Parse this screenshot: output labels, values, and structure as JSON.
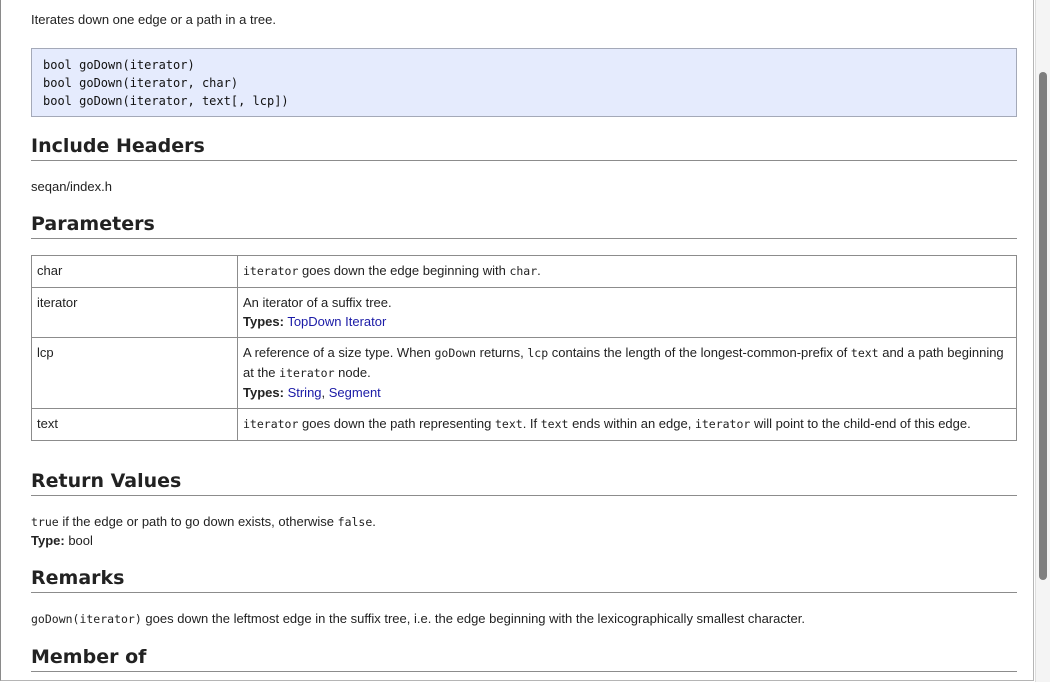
{
  "intro": "Iterates down one edge or a path in a tree.",
  "signatures": [
    "bool goDown(iterator)",
    "bool goDown(iterator, char)",
    "bool goDown(iterator, text[, lcp])"
  ],
  "include_headers": {
    "heading": "Include Headers",
    "value": "seqan/index.h"
  },
  "parameters": {
    "heading": "Parameters",
    "rows": [
      {
        "name": "char",
        "desc": {
          "code1": "iterator",
          "text1": " goes down the edge beginning with ",
          "code2": "char",
          "text2": "."
        }
      },
      {
        "name": "iterator",
        "desc": {
          "text1": "An iterator of a suffix tree.",
          "types_label": "Types:",
          "type1": "TopDown Iterator"
        }
      },
      {
        "name": "lcp",
        "desc": {
          "text1": "A reference of a size type. When ",
          "code1": "goDown",
          "text2": " returns, ",
          "code2": "lcp",
          "text3": " contains the length of the longest-common-prefix of ",
          "code3": "text",
          "text4": " and a path beginning at the ",
          "code4": "iterator",
          "text5": " node.",
          "types_label": "Types:",
          "type1": "String",
          "sep": ", ",
          "type2": "Segment"
        }
      },
      {
        "name": "text",
        "desc": {
          "code1": "iterator",
          "text1": " goes down the path representing ",
          "code2": "text",
          "text2": ". If ",
          "code3": "text",
          "text3": " ends within an edge, ",
          "code4": "iterator",
          "text4": " will point to the child-end of this edge."
        }
      }
    ]
  },
  "return_values": {
    "heading": "Return Values",
    "code_true": "true",
    "text1": " if the edge or path to go down exists, otherwise ",
    "code_false": "false",
    "text2": ".",
    "type_label": "Type:",
    "type_value": " bool"
  },
  "remarks": {
    "heading": "Remarks",
    "code1": "goDown(iterator)",
    "text1": " goes down the leftmost edge in the suffix tree, i.e. the edge beginning with the lexicographically smallest character."
  },
  "member_of": {
    "heading": "Member of"
  }
}
